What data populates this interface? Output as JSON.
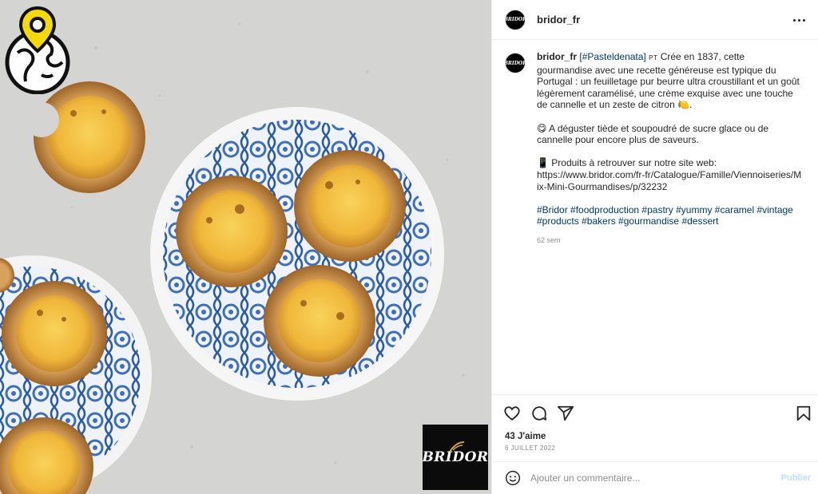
{
  "post": {
    "username": "bridor_fr",
    "avatar_text": "BRIDOR",
    "brand_logo_text": "BRIDOR"
  },
  "caption": {
    "username": "bridor_fr",
    "hashtag_link": "[#Pasteldenata]",
    "lang_code": "PT",
    "paragraph1": "Crée en 1837, cette gourmandise avec une recette généreuse est typique du Portugal : un feuilletage pur beurre ultra croustillant et un goût légèrement caramélisé, une crème exquise avec une touche de cannelle et un zeste de citron 🍋.",
    "paragraph2": "😋 A déguster tiède et soupoudré de sucre glace ou de cannelle pour encore plus de saveurs.",
    "paragraph3_line1": "📱 Produits à retrouver sur notre site web:",
    "paragraph3_line2": "https://www.bridor.com/fr-fr/Catalogue/Famille/Viennoiseries/Mix-Mini-Gourmandises/p/32232",
    "hashtags": "#Bridor #foodproduction #pastry #yummy #caramel #vintage #products #bakers #gourmandise #dessert",
    "time_ago": "62 sem"
  },
  "engagement": {
    "likes": "43 J'aime",
    "date": "6 JUILLET 2022"
  },
  "comment_box": {
    "placeholder": "Ajouter un commentaire...",
    "post_label": "Publier"
  },
  "icons": {
    "more": "more-horizontal-icon",
    "like": "heart-icon",
    "comment": "comment-icon",
    "share": "share-icon",
    "save": "bookmark-icon",
    "emoji": "emoji-icon",
    "location": "globe-location-icon"
  },
  "colors": {
    "link": "#00376b",
    "muted": "#8e8e8e",
    "post_disabled": "#c0dffd",
    "badge_yellow": "#f5d90a"
  }
}
